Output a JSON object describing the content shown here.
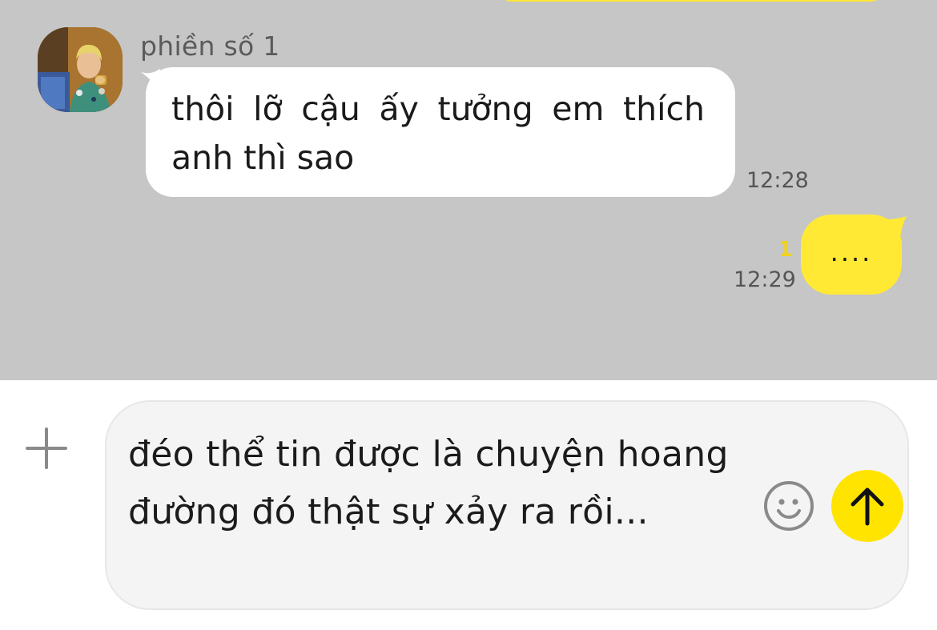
{
  "chat": {
    "incoming": {
      "sender_name": "phiền số 1",
      "text": "thôi lỡ cậu ấy tưởng em thích anh thì sao",
      "time": "12:28"
    },
    "outgoing": {
      "text": "....",
      "time": "12:29",
      "unread_count": "1"
    }
  },
  "composer": {
    "input_text": "đéo thể tin được là chuyện hoang đường đó thật sự xảy ra rồi..."
  },
  "icons": {
    "plus": "plus-icon",
    "emoji": "smiley-icon",
    "send": "arrow-up-icon"
  },
  "colors": {
    "chat_background": "#c6c6c6",
    "outgoing_bubble": "#ffe935",
    "incoming_bubble": "#ffffff",
    "send_button": "#ffe400",
    "unread_count": "#f2d21b"
  }
}
